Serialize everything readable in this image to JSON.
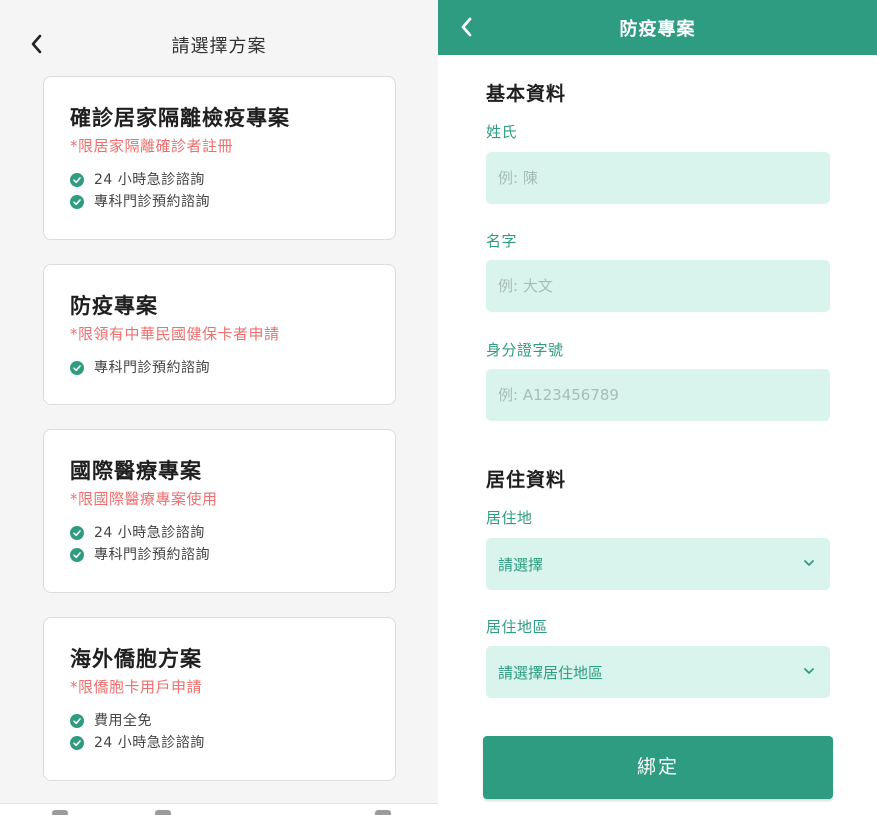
{
  "left": {
    "title": "請選擇方案",
    "plans": [
      {
        "name": "確診居家隔離檢疫專案",
        "note": "*限居家隔離確診者註冊",
        "features": [
          "24 小時急診諮詢",
          "專科門診預約諮詢"
        ]
      },
      {
        "name": "防疫專案",
        "note": "*限領有中華民國健保卡者申請",
        "features": [
          "專科門診預約諮詢"
        ]
      },
      {
        "name": "國際醫療專案",
        "note": "*限國際醫療專案使用",
        "features": [
          "24 小時急診諮詢",
          "專科門診預約諮詢"
        ]
      },
      {
        "name": "海外僑胞方案",
        "note": "*限僑胞卡用戶申請",
        "features": [
          "費用全免",
          "24 小時急診諮詢"
        ]
      }
    ]
  },
  "right": {
    "title": "防疫專案",
    "basic_section": "基本資料",
    "last_name": {
      "label": "姓氏",
      "placeholder": "例: 陳"
    },
    "first_name": {
      "label": "名字",
      "placeholder": "例: 大文"
    },
    "id_number": {
      "label": "身分證字號",
      "placeholder": "例: A123456789"
    },
    "residence_section": "居住資料",
    "residence": {
      "label": "居住地",
      "value": "請選擇"
    },
    "residence_area": {
      "label": "居住地區",
      "value": "請選擇居住地區"
    },
    "submit_label": "綁定"
  },
  "colors": {
    "accent": "#2e9c80",
    "field_bg": "#d8f4ec",
    "note_red": "#ee6f6f"
  },
  "icons": {
    "back": "chevron-left-icon",
    "check": "check-circle-icon",
    "dropdown": "chevron-down-icon"
  }
}
